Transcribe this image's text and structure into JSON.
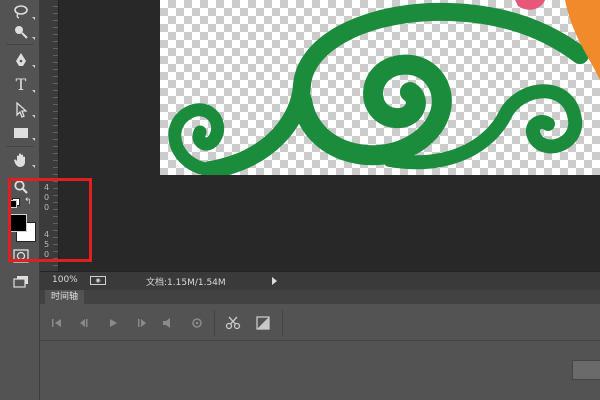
{
  "status_bar": {
    "zoom": "100%",
    "doc_label": "文档:1.15M/1.54M"
  },
  "timeline": {
    "tab_label": "时间轴"
  },
  "toolbar": {
    "type_tool_label": "T"
  },
  "ruler": {
    "labels": [
      "4",
      "0",
      "0",
      "4",
      "5",
      "0"
    ]
  },
  "colors": {
    "ornament_green": "#1a8c3c",
    "highlight_red": "#e02020",
    "foreground_color": "#000000",
    "background_color": "#ffffff"
  }
}
